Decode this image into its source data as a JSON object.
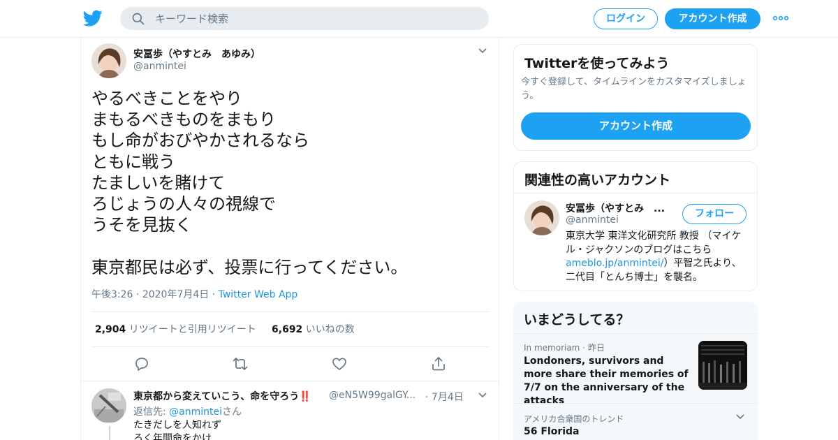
{
  "header": {
    "search_placeholder": "キーワード検索",
    "login_label": "ログイン",
    "signup_label": "アカウント作成"
  },
  "tweet": {
    "author_name": "安冨歩（やすとみ　あゆみ）",
    "author_handle": "@anmintei",
    "text": "やるべきことをやり\nまもるべきものをまもり\nもし命がおびやかされるなら\nともに戦う\nたましいを賭けて\nろじょうの人々の視線で\nうそを見抜く\n\n東京都民は必ず、投票に行ってください。",
    "time": "午後3:26",
    "date": "2020年7月4日",
    "app": "Twitter Web App",
    "retweet_count": "2,904",
    "retweet_label": "リツイートと引用リツイート",
    "like_count": "6,692",
    "like_label": "いいねの数"
  },
  "reply": {
    "author_name": "東京都から変えていこう、命を守ろう‼️",
    "author_handle": "@eN5W99galGY...",
    "date": "7月4日",
    "reply_to_prefix": "返信先: ",
    "reply_to_mention": "@anmintei",
    "reply_to_suffix": "さん",
    "text": "たきだしを人知れず\nろく年間命をかけ"
  },
  "sidebar": {
    "signup_card": {
      "title": "Twitterを使ってみよう",
      "description": "今すぐ登録して、タイムラインをカスタマイズしましょう。",
      "button_label": "アカウント作成"
    },
    "related_card": {
      "title": "関連性の高いアカウント",
      "name": "安冨歩（やすとみ　...",
      "handle": "@anmintei",
      "follow_label": "フォロー",
      "bio_part1": "東京大学 東洋文化研究所 教授 （マイケル・ジャクソンのブログはこちら ",
      "bio_link": "ameblo.jp/anmintei/",
      "bio_part2": "）平智之氏より、二代目「とんち博士」を襲名。"
    },
    "trends_card": {
      "title": "いまどうしてる？",
      "trend1_category": "In memoriam",
      "trend1_time": "昨日",
      "trend1_title": "Londoners, survivors and more share their memories of 7/7 on the anniversary of the attacks",
      "trend2_category": "アメリカ合衆国のトレンド",
      "trend2_title": "56 Florida"
    }
  },
  "colors": {
    "brand": "#1da1f2",
    "link": "#1b95e0",
    "muted": "#657786",
    "border": "#e6ecf0"
  }
}
